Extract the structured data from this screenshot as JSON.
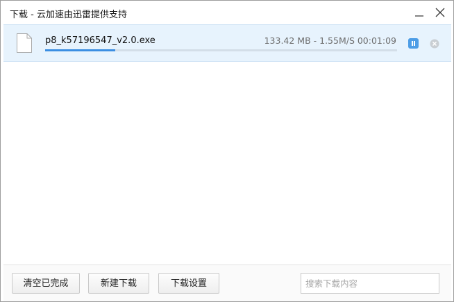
{
  "window": {
    "title": "下载 - 云加速由迅雷提供支持",
    "minimize_icon": "minimize-icon",
    "close_icon": "close-icon"
  },
  "downloads": [
    {
      "file_name": "p8_k57196547_v2.0.exe",
      "status_text": "133.42 MB - 1.55M/S 00:01:09",
      "progress_percent": 20,
      "file_icon": "file-icon",
      "pause_icon": "pause-icon",
      "remove_icon": "remove-icon"
    }
  ],
  "footer": {
    "clear_completed_label": "清空已完成",
    "new_download_label": "新建下载",
    "download_settings_label": "下载设置",
    "search_placeholder": "搜索下载内容"
  },
  "colors": {
    "selected_row_bg": "#e7f3fd",
    "progress_fill": "#3b8ee2",
    "pause_button": "#4d9de6"
  }
}
